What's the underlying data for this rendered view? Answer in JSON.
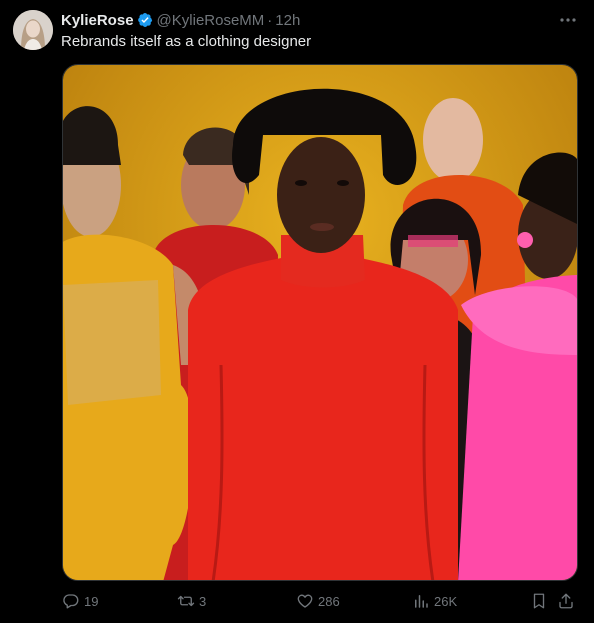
{
  "tweet": {
    "display_name": "KylieRose",
    "handle": "@KylieRoseMM",
    "separator": "·",
    "time": "12h",
    "text": "Rebrands itself as a clothing designer"
  },
  "actions": {
    "replies": "19",
    "reposts": "3",
    "likes": "286",
    "views": "26K"
  },
  "colors": {
    "background": "#000000",
    "text": "#e7e9ea",
    "muted": "#71767b",
    "verified": "#1d9bf0"
  }
}
